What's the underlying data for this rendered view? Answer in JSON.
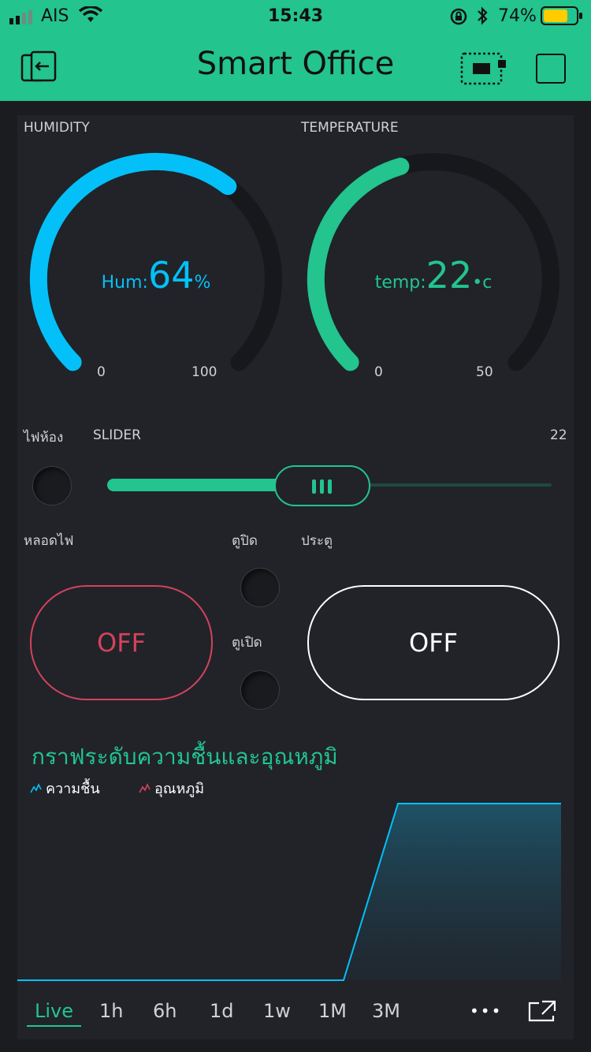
{
  "status_bar": {
    "carrier": "AIS",
    "time": "15:43",
    "battery": "74%"
  },
  "header": {
    "title": "Smart Office"
  },
  "gauges": [
    {
      "label": "HUMIDITY",
      "prefix": "Hum:",
      "value": "64",
      "suffix": "%",
      "min": "0",
      "max": "100",
      "fraction": 0.64,
      "color": "#04c0f8"
    },
    {
      "label": "TEMPERATURE",
      "prefix": "temp:",
      "value": "22",
      "suffix": "•c",
      "min": "0",
      "max": "50",
      "fraction": 0.44,
      "color": "#23c48e"
    }
  ],
  "slider": {
    "led_label": "ไฟห้อง",
    "label": "SLIDER",
    "value": "22",
    "fraction": 0.48
  },
  "lamp": {
    "label": "หลอดไฟ",
    "button_text": "OFF",
    "color": "#d3435c"
  },
  "cabinet": {
    "label_1": "ตูปิด",
    "label_2": "ตูเปิด"
  },
  "door": {
    "label": "ประตู",
    "button_text": "OFF"
  },
  "chart": {
    "title": "กราฟระดับความชื้นและอุณหภูมิ",
    "legend": [
      {
        "name": "ความชื้น",
        "color": "#04c0f8"
      },
      {
        "name": "อุณหภูมิ",
        "color": "#d3435c"
      }
    ],
    "tabs": [
      "Live",
      "1h",
      "6h",
      "1d",
      "1w",
      "1M",
      "3M"
    ],
    "active_tab": "Live",
    "more": "•••"
  },
  "chart_data": {
    "type": "area",
    "series": [
      {
        "name": "ความชื้น",
        "values": [
          0,
          0,
          0,
          0,
          0,
          0,
          0,
          1,
          1,
          1,
          1
        ]
      },
      {
        "name": "อุณหภูมิ",
        "values": []
      }
    ],
    "x": [
      0,
      1,
      2,
      3,
      4,
      5,
      6,
      7,
      8,
      9,
      10
    ]
  }
}
